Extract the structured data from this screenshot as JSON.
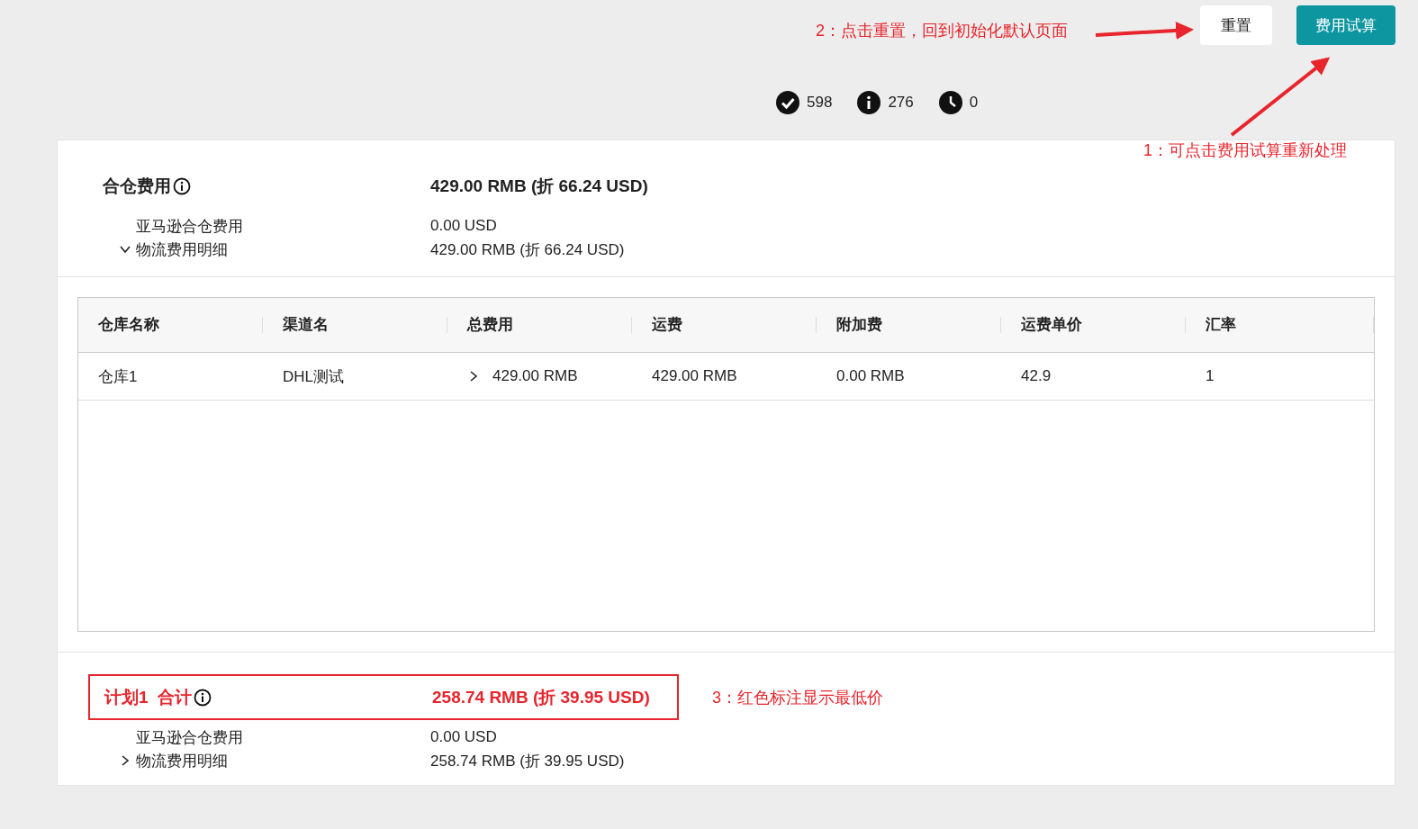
{
  "toolbar": {
    "buttons": [
      {
        "label": "重置",
        "kind": "secondary"
      },
      {
        "label": "费用试算",
        "kind": "primary"
      }
    ]
  },
  "stats": [
    {
      "kind": "success",
      "count": "598"
    },
    {
      "kind": "info",
      "count": "276"
    },
    {
      "kind": "pending",
      "count": "0"
    }
  ],
  "annotations": [
    {
      "kind": "reset",
      "text": "2：点击重置，回到初始化默认页面"
    },
    {
      "kind": "calc",
      "text": "1：可点击费用试算重新处理"
    }
  ],
  "plans": [
    {
      "title": "合仓费用",
      "total": "429.00 RMB (折 66.24 USD)",
      "highlighted": false,
      "details": [
        {
          "label": "亚马逊合仓费用",
          "value": "0.00 USD"
        },
        {
          "label": "物流费用明细",
          "value": "429.00 RMB (折 66.24 USD)",
          "expanded": true
        }
      ],
      "table": {
        "columns": [
          "仓库名称",
          "渠道名",
          "总费用",
          "运费",
          "附加费",
          "运费单价",
          "汇率"
        ],
        "rows": [
          {
            "warehouse": "仓库1",
            "channel": "DHL测试",
            "total": "429.00 RMB",
            "freight": "429.00 RMB",
            "surcharge": "0.00 RMB",
            "unit_price": "42.9",
            "rate": "1",
            "expanded": false
          }
        ]
      }
    },
    {
      "title": "计划1  合计",
      "total": "258.74 RMB (折 39.95 USD)",
      "highlighted": true,
      "note": "3：红色标注显示最低价",
      "details": [
        {
          "label": "亚马逊合仓费用",
          "value": "0.00 USD"
        },
        {
          "label": "物流费用明细",
          "value": "258.74 RMB (折 39.95 USD)",
          "expanded": false
        }
      ]
    }
  ]
}
